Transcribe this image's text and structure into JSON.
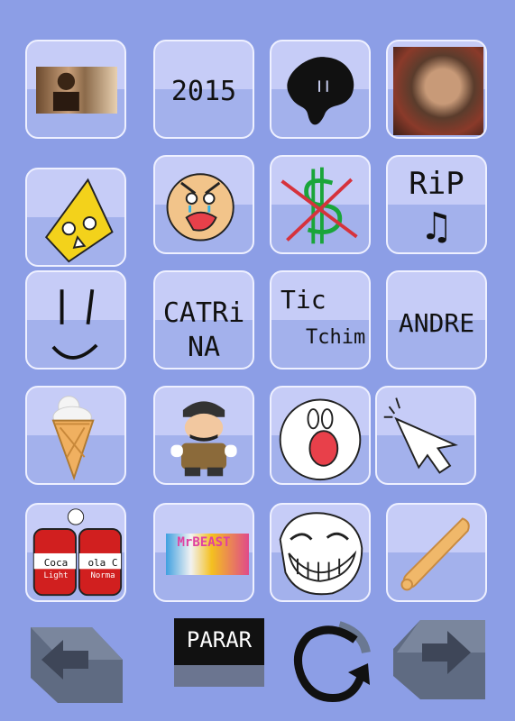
{
  "tiles": [
    {
      "name": "photo-man-tile",
      "kind": "photo"
    },
    {
      "name": "tile-2015",
      "text": "2015"
    },
    {
      "name": "black-blob-tile",
      "kind": "drawing"
    },
    {
      "name": "photo-face-tile",
      "kind": "photo"
    },
    {
      "name": "yellow-diamond-face-tile",
      "kind": "drawing"
    },
    {
      "name": "angry-crying-face-tile",
      "kind": "drawing"
    },
    {
      "name": "no-dollar-tile",
      "kind": "drawing"
    },
    {
      "name": "rip-music-tile",
      "text_line1": "RiP",
      "text_line2": "♫"
    },
    {
      "name": "smiley-lines-tile",
      "kind": "drawing"
    },
    {
      "name": "catrina-tile",
      "text_line1": "CATRi",
      "text_line2": "NA"
    },
    {
      "name": "tic-tchim-tile",
      "text_line1": "Tic",
      "text_line2": "Tchim"
    },
    {
      "name": "andre-tile",
      "text": "ANDRE"
    },
    {
      "name": "ice-cream-tile",
      "kind": "drawing"
    },
    {
      "name": "mario-tile",
      "kind": "drawing"
    },
    {
      "name": "shocked-face-tile",
      "kind": "drawing"
    },
    {
      "name": "cursor-tile",
      "kind": "drawing"
    },
    {
      "name": "soda-cans-tile",
      "can_left": "Coca",
      "can_right": "ola C",
      "can_left_sub": "Light",
      "can_right_sub": "Norma"
    },
    {
      "name": "mrbeast-photo-tile",
      "text": "MrBEAST"
    },
    {
      "name": "trollface-tile",
      "kind": "drawing"
    },
    {
      "name": "bat-tile",
      "kind": "drawing"
    }
  ],
  "controls": {
    "stop_label": "PARAR",
    "prev_icon": "arrow-left-icon",
    "next_icon": "arrow-right-icon",
    "replay_icon": "replay-icon"
  },
  "colors": {
    "background": "#8c9ee6",
    "tile_top": "#c6ccf7",
    "tile_bottom": "#a3b1ec"
  }
}
